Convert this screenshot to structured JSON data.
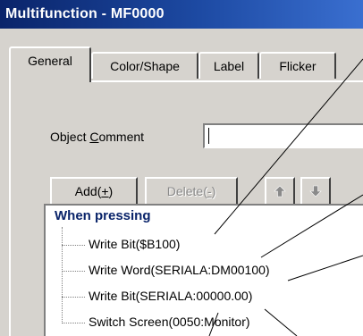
{
  "window": {
    "title": "Multifunction - MF0000"
  },
  "tabs": [
    {
      "label": "General",
      "active": true
    },
    {
      "label": "Color/Shape",
      "active": false
    },
    {
      "label": "Label",
      "active": false
    },
    {
      "label": "Flicker",
      "active": false
    }
  ],
  "general": {
    "comment_label_prefix": "Object ",
    "comment_label_mnemonic": "C",
    "comment_label_suffix": "omment",
    "comment_value": "",
    "buttons": {
      "add_prefix": "Add(",
      "add_mnemonic": "+",
      "add_suffix": ")",
      "delete_prefix": "Delete(",
      "delete_mnemonic": "-",
      "delete_suffix": ")",
      "up_icon": "arrow-up-icon",
      "down_icon": "arrow-down-icon"
    },
    "tree": {
      "root_label": "When pressing",
      "items": [
        "Write Bit($B100)",
        "Write Word(SERIALA:DM00100)",
        "Write Bit(SERIALA:00000.00)",
        "Switch Screen(0050:Monitor)"
      ]
    }
  },
  "colors": {
    "title_bar": "#0a246a",
    "face": "#d6d3ce",
    "tree_root_text": "#0a246a"
  }
}
